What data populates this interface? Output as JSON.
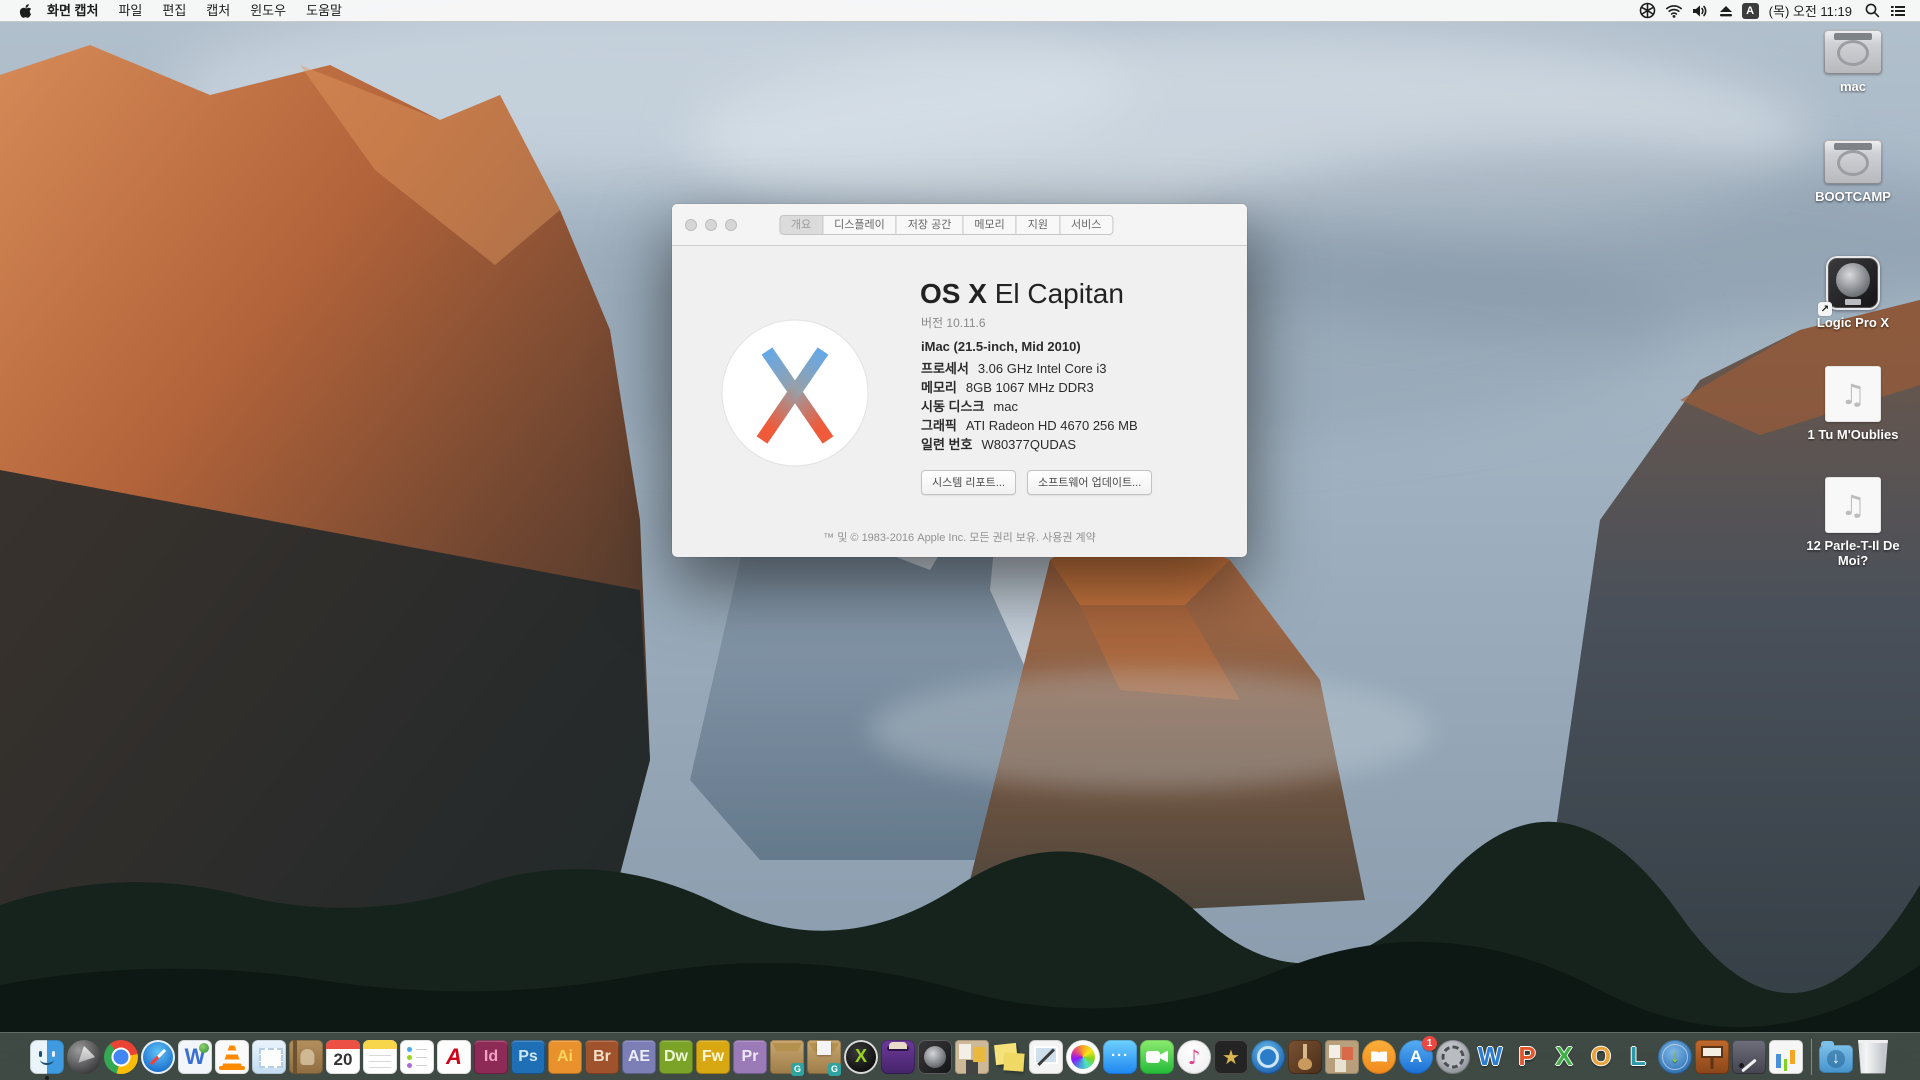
{
  "menubar": {
    "menus": [
      "화면 캡처",
      "파일",
      "편집",
      "캡처",
      "윈도우",
      "도움말"
    ],
    "status": {
      "input_label": "A",
      "clock": "(목) 오전 11:19",
      "icons": [
        "fan-icon",
        "wifi-icon",
        "volume-icon",
        "eject-icon",
        "input-source-icon",
        "spotlight-icon",
        "notification-center-icon"
      ]
    }
  },
  "about_window": {
    "tabs": [
      {
        "label": "개요",
        "selected": true
      },
      {
        "label": "디스플레이",
        "selected": false
      },
      {
        "label": "저장 공간",
        "selected": false
      },
      {
        "label": "메모리",
        "selected": false
      },
      {
        "label": "지원",
        "selected": false
      },
      {
        "label": "서비스",
        "selected": false
      }
    ],
    "title_strong": "OS X",
    "title_light": " El Capitan",
    "version": "버전 10.11.6",
    "model": "iMac (21.5-inch, Mid 2010)",
    "specs": [
      {
        "label": "프로세서",
        "value": "3.06 GHz Intel Core i3"
      },
      {
        "label": "메모리",
        "value": "8GB 1067 MHz DDR3"
      },
      {
        "label": "시동 디스크",
        "value": "mac"
      },
      {
        "label": "그래픽",
        "value": "ATI Radeon HD 4670 256 MB"
      },
      {
        "label": "일련 번호",
        "value": "W80377QUDAS"
      }
    ],
    "buttons": [
      "시스템 리포트...",
      "소프트웨어 업데이트..."
    ],
    "footer": "™ 및 © 1983-2016 Apple Inc. 모든 권리 보유. 사용권 계약"
  },
  "desktop_icons": [
    {
      "name": "mac",
      "label": "mac",
      "kind": "drive"
    },
    {
      "name": "bootcamp",
      "label": "BOOTCAMP",
      "kind": "drive"
    },
    {
      "name": "logic-pro-x",
      "label": "Logic Pro X",
      "kind": "logic",
      "alias": true
    },
    {
      "name": "tu-m-oublies",
      "label": "1 Tu M'Oublies",
      "kind": "audio"
    },
    {
      "name": "parle-t-il-de-moi",
      "label": "12 Parle-T-Il De Moi?",
      "kind": "audio"
    }
  ],
  "dock": {
    "items": [
      {
        "name": "finder",
        "kind": "finder",
        "running": true
      },
      {
        "name": "launchpad",
        "kind": "launchpad"
      },
      {
        "name": "chrome",
        "kind": "chrome"
      },
      {
        "name": "safari",
        "kind": "safari"
      },
      {
        "name": "w-globe-app",
        "kind": "wapp",
        "glyph": "W"
      },
      {
        "name": "vlc",
        "kind": "vlc"
      },
      {
        "name": "mail",
        "kind": "mail"
      },
      {
        "name": "contacts",
        "kind": "contacts"
      },
      {
        "name": "calendar",
        "kind": "calendar",
        "glyph": "20"
      },
      {
        "name": "notes",
        "kind": "notes"
      },
      {
        "name": "reminders",
        "kind": "reminders"
      },
      {
        "name": "acrobat",
        "kind": "acrobat",
        "glyph": "A"
      },
      {
        "name": "indesign",
        "kind": "adobe",
        "glyph": "Id",
        "bg": "#8e2a56",
        "fg": "#f3a0c6"
      },
      {
        "name": "photoshop",
        "kind": "adobe",
        "glyph": "Ps",
        "bg": "#1f6fb6",
        "fg": "#cde6f7"
      },
      {
        "name": "illustrator",
        "kind": "adobe",
        "glyph": "Ai",
        "bg": "#e8912d",
        "fg": "#ffd65c"
      },
      {
        "name": "bridge",
        "kind": "adobe",
        "glyph": "Br",
        "bg": "#a0522d",
        "fg": "#f3e0c8"
      },
      {
        "name": "after-effects",
        "kind": "adobe",
        "glyph": "AE",
        "bg": "#7b7fb5",
        "fg": "#ecedf8"
      },
      {
        "name": "dreamweaver",
        "kind": "adobe",
        "glyph": "Dw",
        "bg": "#7aa327",
        "fg": "#eef7d8"
      },
      {
        "name": "fireworks",
        "kind": "adobe",
        "glyph": "Fw",
        "bg": "#d8a813",
        "fg": "#fff8d8"
      },
      {
        "name": "premiere",
        "kind": "adobe",
        "glyph": "Pr",
        "bg": "#9a7bb8",
        "fg": "#f0e8f8"
      },
      {
        "name": "stuffit-expander",
        "kind": "stuffit",
        "glyph": "G"
      },
      {
        "name": "dropstuff",
        "kind": "dropstuff",
        "glyph": "G"
      },
      {
        "name": "quark-x-app",
        "kind": "quark",
        "glyph": "X"
      },
      {
        "name": "toast",
        "kind": "toast"
      },
      {
        "name": "logic-pro",
        "kind": "logicdock"
      },
      {
        "name": "craft-app",
        "kind": "collage"
      },
      {
        "name": "stickies",
        "kind": "stickies"
      },
      {
        "name": "grab-screen-capture",
        "kind": "grab",
        "running": true
      },
      {
        "name": "photos",
        "kind": "photos"
      },
      {
        "name": "messages",
        "kind": "messages",
        "glyph": "···"
      },
      {
        "name": "facetime",
        "kind": "facetime"
      },
      {
        "name": "itunes",
        "kind": "itunes",
        "glyph": "♪"
      },
      {
        "name": "imovie",
        "kind": "imovie",
        "glyph": "★"
      },
      {
        "name": "dvd-player",
        "kind": "dvd"
      },
      {
        "name": "garageband",
        "kind": "garageband"
      },
      {
        "name": "pinboard-app",
        "kind": "collage2"
      },
      {
        "name": "ibooks",
        "kind": "ibooks"
      },
      {
        "name": "app-store",
        "kind": "appstore",
        "glyph": "A",
        "badge": "1"
      },
      {
        "name": "system-preferences",
        "kind": "sysprefs"
      },
      {
        "name": "word",
        "kind": "office",
        "glyph": "W",
        "fg": "#2b7cd3"
      },
      {
        "name": "powerpoint",
        "kind": "office",
        "glyph": "P",
        "fg": "#e2562b"
      },
      {
        "name": "excel",
        "kind": "office",
        "glyph": "X",
        "fg": "#3faf46"
      },
      {
        "name": "outlook",
        "kind": "office",
        "glyph": "O",
        "fg": "#e8a33d"
      },
      {
        "name": "lync",
        "kind": "office",
        "glyph": "L",
        "fg": "#2b9aa8"
      },
      {
        "name": "web-downloader",
        "kind": "webdl",
        "glyph": "↓"
      },
      {
        "name": "keynote",
        "kind": "keynote"
      },
      {
        "name": "pages",
        "kind": "pages"
      },
      {
        "name": "numbers",
        "kind": "numbersapp"
      },
      {
        "name": "dock-separator",
        "kind": "separator"
      },
      {
        "name": "downloads-folder",
        "kind": "downloads",
        "glyph": "↓"
      },
      {
        "name": "trash",
        "kind": "trash"
      }
    ]
  },
  "colors": {
    "badge_red": "#ec4842",
    "logo_blue": "#64a8e8",
    "logo_orange": "#ee5a3a",
    "menubar_bg": "#f8f8f8",
    "dock_bg": "#6a746e"
  }
}
